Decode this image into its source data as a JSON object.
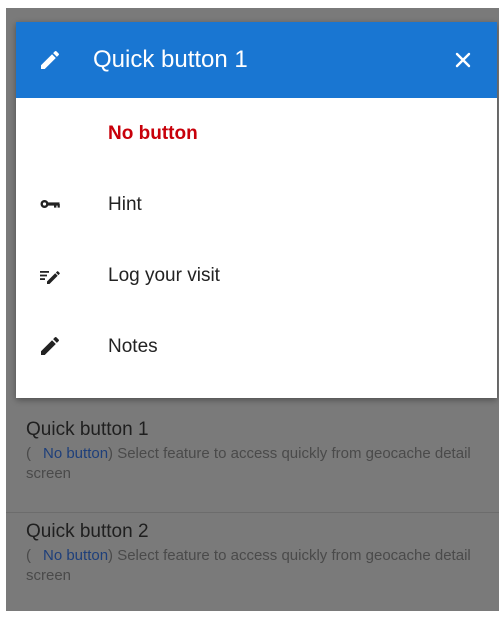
{
  "dialog": {
    "title": "Quick button 1",
    "header_color": "#1976d2",
    "header_icon": "pencil-icon",
    "close_icon": "close-icon",
    "items": [
      {
        "label": "No button",
        "icon": "",
        "selected": true
      },
      {
        "label": "Hint",
        "icon": "key-icon",
        "selected": false
      },
      {
        "label": "Log your visit",
        "icon": "log-visit-icon",
        "selected": false
      },
      {
        "label": "Notes",
        "icon": "pencil-icon",
        "selected": false
      }
    ],
    "selected_color": "#c8000a"
  },
  "background": {
    "rows": [
      {
        "title": "Quick button 1",
        "summary_open": "(",
        "summary_value": "No button",
        "summary_rest": ") Select feature to access quickly from geocache detail screen"
      },
      {
        "title": "Quick button 2",
        "summary_open": "(",
        "summary_value": "No button",
        "summary_rest": ") Select feature to access quickly from geocache detail screen"
      }
    ]
  }
}
